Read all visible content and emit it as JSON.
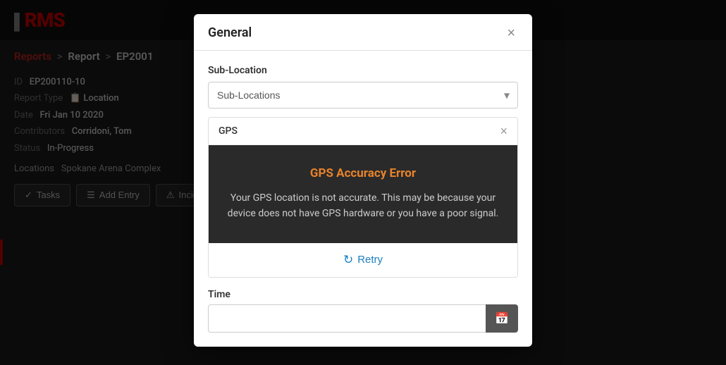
{
  "app": {
    "logo": "RMS",
    "logo_prefix": ""
  },
  "breadcrumb": {
    "reports": "Reports",
    "sep1": ">",
    "report": "Report",
    "sep2": ">",
    "id": "EP2001"
  },
  "report": {
    "id_label": "ID",
    "id_value": "EP200110-10",
    "type_label": "Report Type",
    "type_icon": "📋",
    "type_value": "Location",
    "date_label": "Date",
    "date_value": "Fri Jan 10 2020",
    "contributors_label": "Contributors",
    "contributors_value": "Corridoni, Tom",
    "status_label": "Status",
    "status_value": "In-Progress",
    "locations_label": "Locations",
    "locations_value": "Spokane Arena Complex"
  },
  "buttons": {
    "tasks_label": "Tasks",
    "add_entry_label": "Add Entry",
    "incident_label": "Incident"
  },
  "modal": {
    "title": "General",
    "close_label": "×",
    "sub_location": {
      "label": "Sub-Location",
      "placeholder": "Sub-Locations"
    },
    "gps": {
      "header_label": "GPS",
      "close_label": "×",
      "error_title": "GPS Accuracy Error",
      "error_message": "Your GPS location is not accurate. This may be because your device does not have GPS hardware or you have a poor signal.",
      "retry_label": "Retry",
      "retry_icon": "🔄"
    },
    "time": {
      "label": "Time",
      "placeholder": ""
    }
  }
}
